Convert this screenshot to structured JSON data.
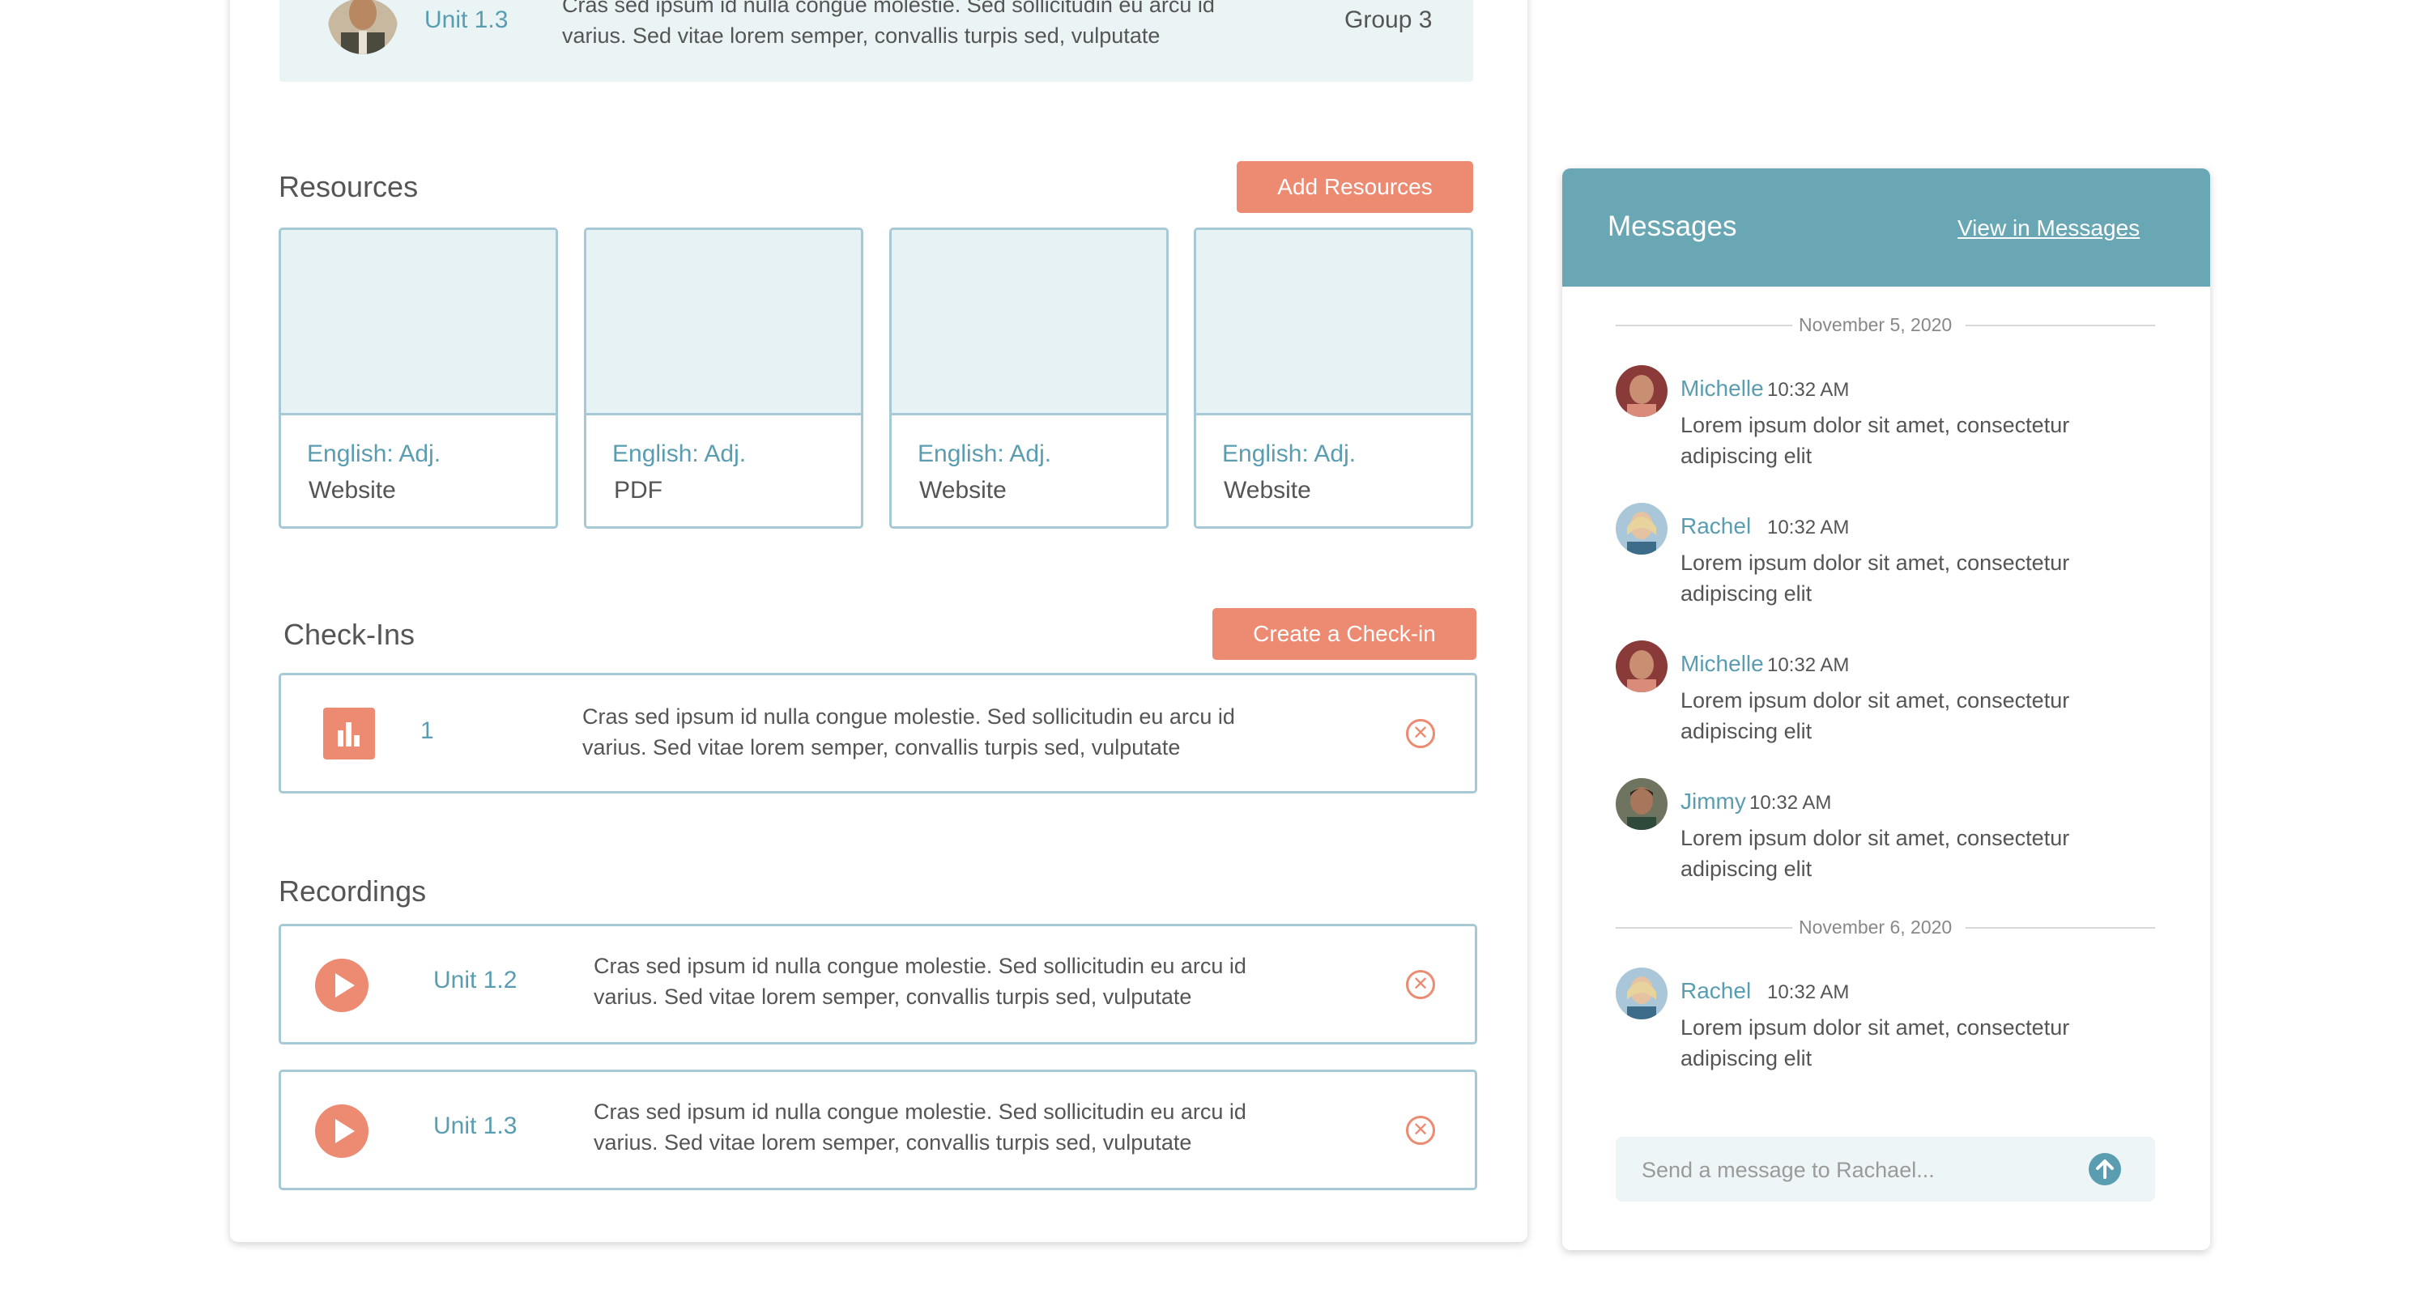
{
  "top_row": {
    "unit": "Unit 1.3",
    "desc_line1": "Cras sed ipsum id nulla congue molestie. Sed sollicitudin eu arcu id",
    "desc_line2": "varius. Sed vitae lorem semper, convallis turpis sed, vulputate",
    "group": "Group 3"
  },
  "resources": {
    "title": "Resources",
    "add_label": "Add Resources",
    "items": [
      {
        "lang": "English:  Adj.",
        "type": "Website"
      },
      {
        "lang": "English:  Adj.",
        "type": "PDF"
      },
      {
        "lang": "English:  Adj.",
        "type": "Website"
      },
      {
        "lang": "English:  Adj.",
        "type": "Website"
      }
    ]
  },
  "checkins": {
    "title": "Check-Ins",
    "create_label": "Create a Check-in",
    "items": [
      {
        "number": "1",
        "desc_line1": "Cras sed ipsum id nulla congue molestie. Sed sollicitudin eu arcu id",
        "desc_line2": "varius. Sed vitae lorem semper, convallis turpis sed, vulputate"
      }
    ]
  },
  "recordings": {
    "title": "Recordings",
    "items": [
      {
        "unit": "Unit 1.2",
        "desc_line1": "Cras sed ipsum id nulla congue molestie. Sed sollicitudin eu arcu id",
        "desc_line2": "varius. Sed vitae lorem semper, convallis turpis sed, vulputate"
      },
      {
        "unit": "Unit 1.3",
        "desc_line1": "Cras sed ipsum id nulla congue molestie. Sed sollicitudin eu arcu id",
        "desc_line2": "varius. Sed vitae lorem semper, convallis turpis sed, vulputate"
      }
    ]
  },
  "messages": {
    "title": "Messages",
    "view_link": "View in Messages",
    "dates": [
      "November 5, 2020",
      "November 6, 2020"
    ],
    "items": [
      {
        "name": "Michelle",
        "time": "10:32 AM",
        "line1": "Lorem ipsum dolor sit amet, consectetur",
        "line2": "adipiscing elit"
      },
      {
        "name": "Rachel",
        "time": "10:32 AM",
        "line1": "Lorem ipsum dolor sit amet, consectetur",
        "line2": "adipiscing elit"
      },
      {
        "name": "Michelle",
        "time": "10:32 AM",
        "line1": "Lorem ipsum dolor sit amet, consectetur",
        "line2": "adipiscing elit"
      },
      {
        "name": "Jimmy",
        "time": "10:32 AM",
        "line1": "Lorem ipsum dolor sit amet, consectetur",
        "line2": "adipiscing elit"
      },
      {
        "name": "Rachel",
        "time": "10:32 AM",
        "line1": "Lorem ipsum dolor sit amet, consectetur",
        "line2": "adipiscing elit"
      }
    ],
    "input_placeholder": "Send a message to Rachael..."
  },
  "colors": {
    "accent": "#ec8a72",
    "teal": "#69a7b5",
    "link": "#5a9db1",
    "border": "#a6c9d5"
  },
  "icons": {
    "checkin": "bar-chart-icon",
    "recording": "play-icon",
    "remove": "close-circle-icon",
    "send": "arrow-up-circle-icon"
  }
}
